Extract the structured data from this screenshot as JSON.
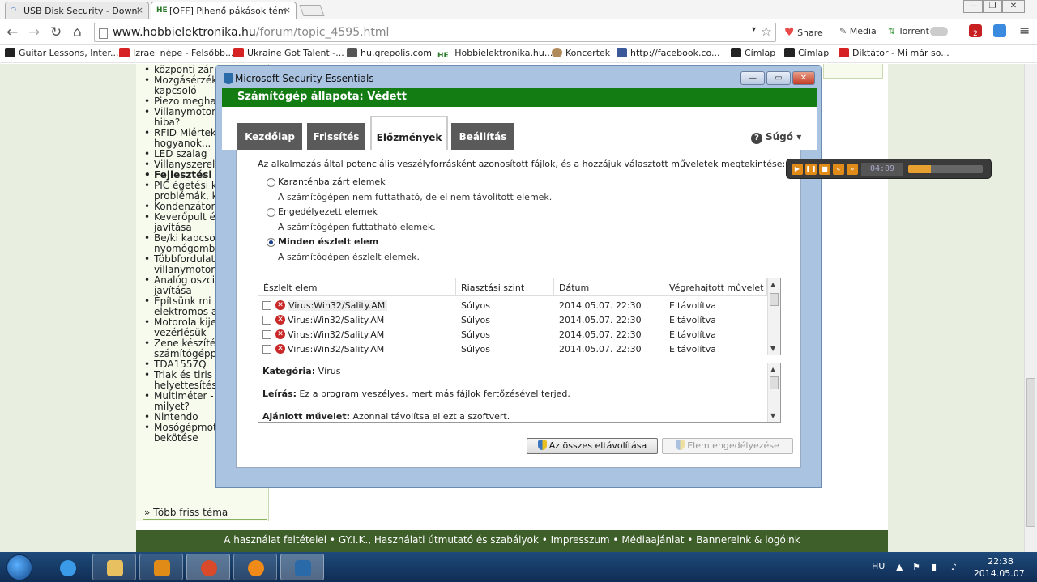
{
  "browser": {
    "tabs": [
      {
        "title": "USB Disk Security - Downl",
        "close": "×"
      },
      {
        "title": "[OFF] Pihenő pákások tém",
        "favicon": "HE",
        "close": "×"
      }
    ],
    "window_controls": {
      "minimize": "—",
      "restore": "❐",
      "close": "✕"
    },
    "url": {
      "host": "www.hobbielektronika.hu",
      "path": "/forum/topic_4595.html"
    },
    "extensions": {
      "share": "Share",
      "media": "Media",
      "torrent": "Torrent",
      "badge": "2"
    },
    "bookmarks": [
      {
        "label": "Guitar Lessons, Inter...",
        "color": "#222222"
      },
      {
        "label": "Izrael népe - Felsőbb...",
        "color": "#d62222"
      },
      {
        "label": "Ukraine Got Talent -...",
        "color": "#d62222"
      },
      {
        "label": "hu.grepolis.com",
        "color": "#555555"
      },
      {
        "label": "Hobbielektronika.hu...",
        "color": "#2a7a2a",
        "favicon": "HE"
      },
      {
        "label": "Koncertek",
        "color": "#b08a5a"
      },
      {
        "label": "http://facebook.co...",
        "color": "#3b5998"
      },
      {
        "label": "Címlap",
        "color": "#222222"
      },
      {
        "label": "Címlap",
        "color": "#222222"
      },
      {
        "label": "Diktátor - Mi már so...",
        "color": "#d62222"
      }
    ]
  },
  "sidebar": {
    "items": [
      {
        "label": "központi zár",
        "bold": false
      },
      {
        "label": "Mozgásérzékelő kapcsoló",
        "bold": false
      },
      {
        "label": "Piezo megha",
        "bold": false
      },
      {
        "label": "Villanymotor hiba?",
        "bold": false
      },
      {
        "label": "RFID Miértek hogyanok...",
        "bold": false
      },
      {
        "label": "LED szalag",
        "bold": false
      },
      {
        "label": "Villanyszerel",
        "bold": false
      },
      {
        "label": "Fejlesztési ö",
        "bold": true
      },
      {
        "label": "PIC égetési k problémák, k",
        "bold": false
      },
      {
        "label": "Kondenzátor",
        "bold": false
      },
      {
        "label": "Keverőpult é javítása",
        "bold": false
      },
      {
        "label": "Be/ki kapcso nyomógomb",
        "bold": false
      },
      {
        "label": "Többfordulat villanymotor",
        "bold": false
      },
      {
        "label": "Analóg oszci javítása",
        "bold": false
      },
      {
        "label": "Építsünk mi i elektromos a",
        "bold": false
      },
      {
        "label": "Motorola kije vezérlésük",
        "bold": false
      },
      {
        "label": "Zene készíté számítógépp",
        "bold": false
      },
      {
        "label": "TDA1557Q",
        "bold": false
      },
      {
        "label": "Triak és tiris helyettesítés",
        "bold": false
      },
      {
        "label": "Multiméter - milyet?",
        "bold": false
      },
      {
        "label": "Nintendo",
        "bold": false
      },
      {
        "label": "Mosógépmot bekötése",
        "bold": false
      }
    ],
    "more_link": "» Több friss téma"
  },
  "footer": "A használat feltételei • GY.I.K., Használati útmutató és szabályok • Impresszum • Médiaajánlat • Bannereink & logóink",
  "mse": {
    "title": "Microsoft Security Essentials",
    "controls": {
      "minimize": "—",
      "maximize": "▭",
      "close": "✕"
    },
    "status": "Számítógép állapota: Védett",
    "tabs": [
      "Kezdőlap",
      "Frissítés",
      "Előzmények",
      "Beállítás"
    ],
    "active_tab": "Előzmények",
    "help": "Súgó ▾",
    "intro": "Az alkalmazás által potenciális veszélyforrásként azonosított fájlok, és a hozzájuk választott műveletek megtekintése:",
    "options": [
      {
        "label": "Karanténba zárt elemek",
        "desc": "A számítógépen nem futtatható, de el nem távolított elemek.",
        "selected": false
      },
      {
        "label": "Engedélyezett elemek",
        "desc": "A számítógépen futtatható elemek.",
        "selected": false
      },
      {
        "label": "Minden észlelt elem",
        "desc": "A számítógépen észlelt elemek.",
        "selected": true
      }
    ],
    "grid": {
      "columns": [
        "Észlelt elem",
        "Riasztási szint",
        "Dátum",
        "Végrehajtott művelet"
      ],
      "rows": [
        {
          "item": "Virus:Win32/Sality.AM",
          "level": "Súlyos",
          "date": "2014.05.07. 22:30",
          "action": "Eltávolítva"
        },
        {
          "item": "Virus:Win32/Sality.AM",
          "level": "Súlyos",
          "date": "2014.05.07. 22:30",
          "action": "Eltávolítva"
        },
        {
          "item": "Virus:Win32/Sality.AM",
          "level": "Súlyos",
          "date": "2014.05.07. 22:30",
          "action": "Eltávolítva"
        },
        {
          "item": "Virus:Win32/Sality.AM",
          "level": "Súlyos",
          "date": "2014.05.07. 22:30",
          "action": "Eltávolítva"
        }
      ]
    },
    "details": {
      "category_label": "Kategória:",
      "category": "Vírus",
      "description_label": "Leírás:",
      "description": "Ez a program veszélyes, mert más fájlok fertőzésével terjed.",
      "recommended_label": "Ajánlott művelet:",
      "recommended": "Azonnal távolítsa el ezt a szoftvert."
    },
    "buttons": {
      "remove_all": "Az összes eltávolítása",
      "allow": "Elem engedélyezése"
    }
  },
  "player": {
    "time": "04:09",
    "progress": 0.3
  },
  "taskbar": {
    "lang": "HU",
    "time": "22:38",
    "date": "2014.05.07."
  }
}
